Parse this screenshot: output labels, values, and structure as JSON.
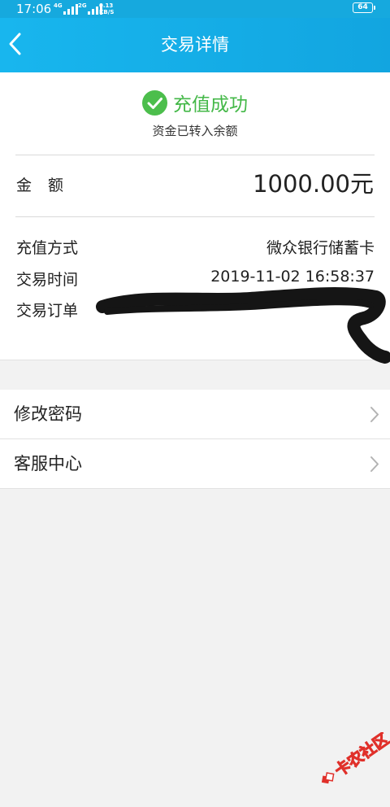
{
  "status_bar": {
    "time": "17:06",
    "sim1_tag": "4G",
    "sim2_tag": "2G",
    "net_speed_value": "0.13",
    "net_speed_unit": "KB/S",
    "battery": "64"
  },
  "nav": {
    "title": "交易详情",
    "back_icon": "chevron-left-icon"
  },
  "result": {
    "status_icon": "check-circle-icon",
    "title": "充值成功",
    "subtitle": "资金已转入余额",
    "status_color": "#44b848"
  },
  "amount": {
    "label": "金额",
    "value": "1000.00元"
  },
  "details": [
    {
      "label": "充值方式",
      "value": "微众银行储蓄卡"
    },
    {
      "label": "交易时间",
      "value": "2019-11-02 16:58:37"
    },
    {
      "label": "交易订单",
      "value": ""
    }
  ],
  "menu": [
    {
      "label": "修改密码",
      "icon": "chevron-right-icon"
    },
    {
      "label": "客服中心",
      "icon": "chevron-right-icon"
    }
  ],
  "watermark": {
    "text": "卡农社区"
  },
  "colors": {
    "header": "#16a9de",
    "success": "#44b848",
    "watermark": "#e0302a"
  }
}
